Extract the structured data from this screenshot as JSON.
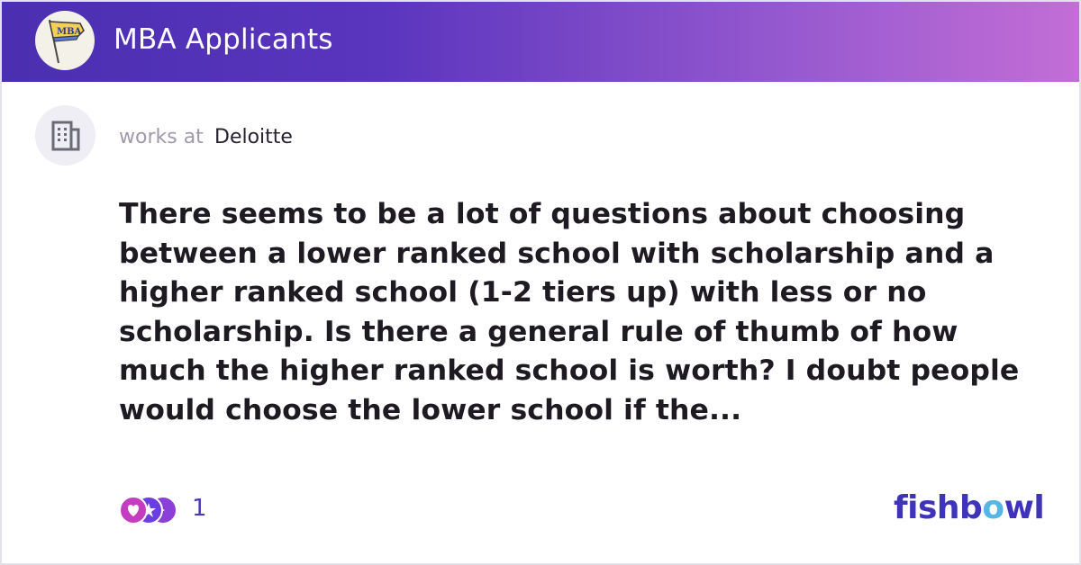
{
  "header": {
    "bowl_name": "MBA Applicants",
    "logo_icon": "mba-pennant-icon",
    "logo_text": "MBA"
  },
  "author": {
    "works_at_label": "works at",
    "company": "Deloitte",
    "avatar_icon": "building-icon"
  },
  "post": {
    "text": "There seems to be a lot of questions about choosing between a lower ranked school with scholarship and a higher ranked school (1-2 tiers up) with less or no scholarship. Is there a general rule of thumb of how much the higher ranked school is worth? I doubt people would choose the lower school if the..."
  },
  "footer": {
    "reaction_count": "1",
    "reaction_icons": [
      "heart-reaction-icon",
      "star-reaction-icon",
      "clap-reaction-icon"
    ],
    "brand_prefix": "fishb",
    "brand_o": "o",
    "brand_suffix": "wl"
  },
  "colors": {
    "header_start": "#4a2fb0",
    "header_end": "#c46ed6",
    "brand": "#3f34b9",
    "brand_accent": "#55b6e6"
  }
}
